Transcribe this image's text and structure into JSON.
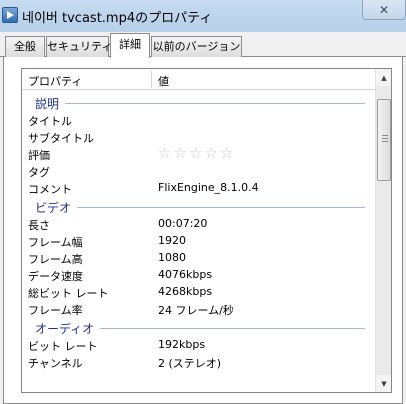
{
  "window": {
    "title": "네이버 tvcast.mp4のプロパティ",
    "close_glyph": "✕"
  },
  "tabs": [
    {
      "label": "全般"
    },
    {
      "label": "セキュリティ"
    },
    {
      "label": "詳細"
    },
    {
      "label": "以前のバージョン"
    }
  ],
  "active_tab": "詳細",
  "list": {
    "headers": {
      "property": "プロパティ",
      "value": "値"
    },
    "groups": {
      "description": {
        "label": "説明",
        "rows": [
          {
            "name": "タイトル",
            "value": ""
          },
          {
            "name": "サブタイトル",
            "value": ""
          },
          {
            "name": "評価",
            "value": "",
            "rating_stars": 0,
            "rating_max": 5
          },
          {
            "name": "タグ",
            "value": ""
          },
          {
            "name": "コメント",
            "value": "FlixEngine_8.1.0.4"
          }
        ]
      },
      "video": {
        "label": "ビデオ",
        "rows": [
          {
            "name": "長さ",
            "value": "00:07:20"
          },
          {
            "name": "フレーム幅",
            "value": "1920"
          },
          {
            "name": "フレーム高",
            "value": "1080"
          },
          {
            "name": "データ速度",
            "value": "4076kbps"
          },
          {
            "name": "総ビット レート",
            "value": "4268kbps"
          },
          {
            "name": "フレーム率",
            "value": "24 フレーム/秒"
          }
        ]
      },
      "audio": {
        "label": "オーディオ",
        "rows": [
          {
            "name": "ビット レート",
            "value": "192kbps"
          },
          {
            "name": "チャンネル",
            "value": "2 (ステレオ)"
          }
        ]
      }
    }
  },
  "icons": {
    "star": "☆",
    "scroll_up": "▲",
    "scroll_down": "▼"
  }
}
